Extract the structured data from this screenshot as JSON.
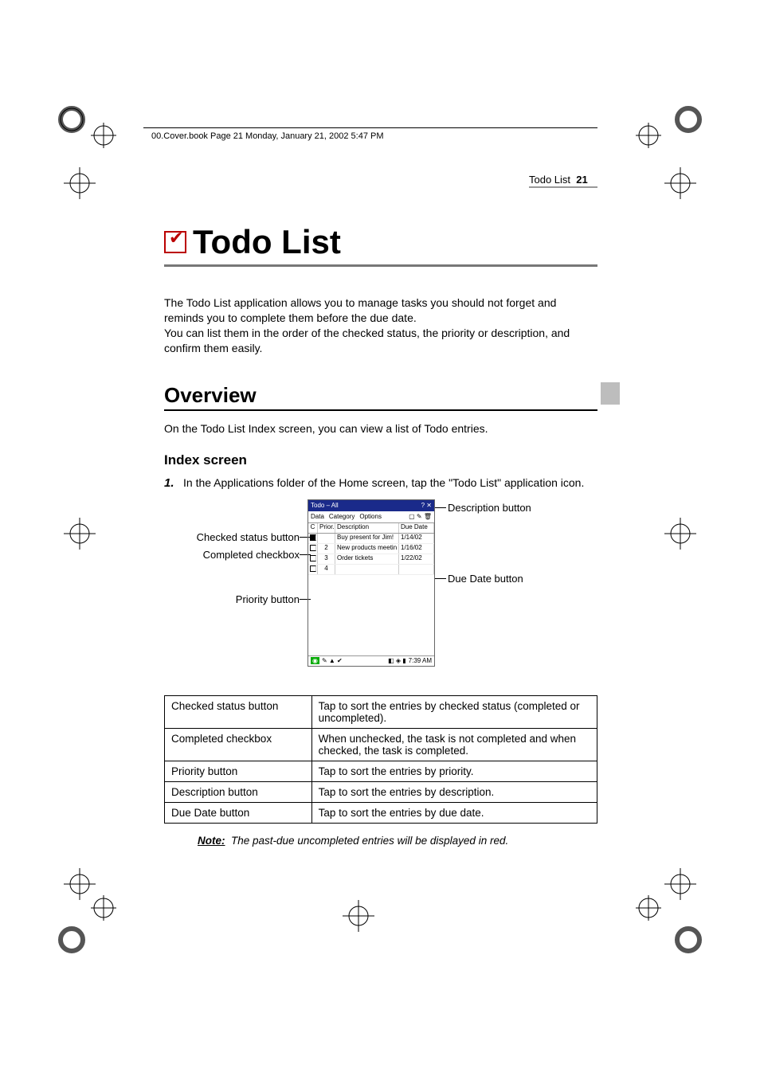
{
  "print_header": "00.Cover.book  Page 21  Monday, January 21, 2002  5:47 PM",
  "running_head": {
    "section": "Todo List",
    "page": "21"
  },
  "title": "Todo List",
  "intro1": "The Todo List application allows you to manage tasks you should not forget and reminds you to complete them before the due date.",
  "intro2": "You can list them in the order of the checked status, the priority or description, and confirm them easily.",
  "overview_heading": "Overview",
  "overview_text": "On the Todo List Index screen, you can view a list of Todo entries.",
  "index_heading": "Index screen",
  "step1_num": "1.",
  "step1_text": "In the Applications folder of the Home screen, tap the \"Todo List\" application icon.",
  "callouts": {
    "checked_status": "Checked status button",
    "completed_checkbox": "Completed checkbox",
    "priority_button": "Priority button",
    "description_button": "Description button",
    "due_date_button": "Due Date button"
  },
  "figure": {
    "titlebar": "Todo – All",
    "menus": [
      "Data",
      "Category",
      "Options"
    ],
    "header": {
      "c": "C",
      "prior": "Prior.",
      "desc": "Description",
      "due": "Due Date"
    },
    "rows": [
      {
        "checked": true,
        "prior": "",
        "desc": "Buy present for Jim!",
        "due": "1/14/02"
      },
      {
        "checked": false,
        "prior": "2",
        "desc": "New products meetin",
        "due": "1/16/02"
      },
      {
        "checked": false,
        "prior": "3",
        "desc": "Order tickets",
        "due": "1/22/02"
      },
      {
        "checked": false,
        "prior": "4",
        "desc": "",
        "due": ""
      }
    ],
    "time": "7:39 AM"
  },
  "table": [
    {
      "name": "Checked status button",
      "desc": "Tap to sort the entries by checked status (completed or uncompleted)."
    },
    {
      "name": "Completed checkbox",
      "desc": "When unchecked, the task is not completed and when checked, the task is completed."
    },
    {
      "name": "Priority button",
      "desc": "Tap to sort the entries by priority."
    },
    {
      "name": "Description button",
      "desc": "Tap to sort the entries by description."
    },
    {
      "name": "Due Date button",
      "desc": "Tap to sort the entries by due date."
    }
  ],
  "note_label": "Note:",
  "note_text": "The past-due uncompleted entries will be displayed in red."
}
